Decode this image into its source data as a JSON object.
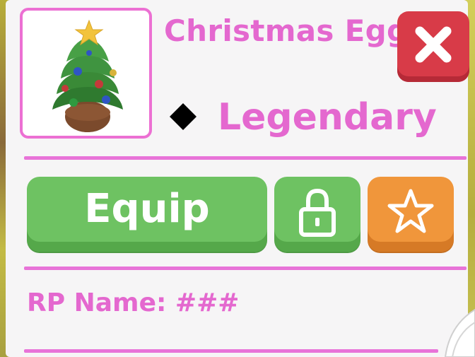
{
  "item": {
    "name": "Christmas Egg",
    "rarity": "Legendary",
    "image_icon": "christmas-tree-egg-icon",
    "rarity_icon": "diamond-icon"
  },
  "actions": {
    "equip_label": "Equip",
    "lock_icon": "lock-icon",
    "favorite_icon": "star-icon",
    "close_icon": "close-icon"
  },
  "rp": {
    "text": "RP Name: ###"
  },
  "colors": {
    "accent_pink": "#e468cf",
    "button_green": "#6ec262",
    "button_orange": "#f0963b",
    "close_red": "#d83b48",
    "panel_bg": "#f6f5f6"
  }
}
